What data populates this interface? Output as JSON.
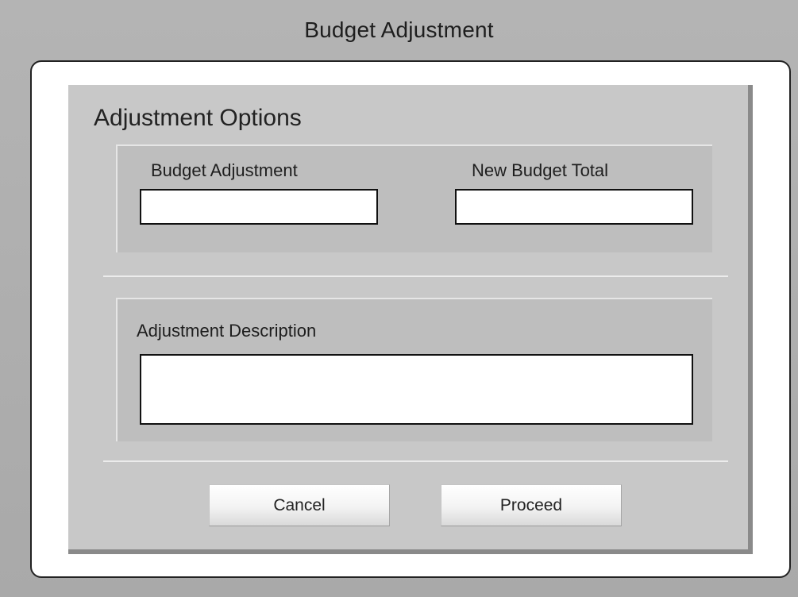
{
  "window": {
    "title": "Budget Adjustment"
  },
  "panel": {
    "section_title": "Adjustment Options",
    "budget_adjustment": {
      "label": "Budget Adjustment",
      "value": ""
    },
    "new_budget_total": {
      "label": "New Budget Total",
      "value": ""
    },
    "adjustment_description": {
      "label": "Adjustment Description",
      "value": ""
    }
  },
  "buttons": {
    "cancel_label": "Cancel",
    "proceed_label": "Proceed"
  }
}
